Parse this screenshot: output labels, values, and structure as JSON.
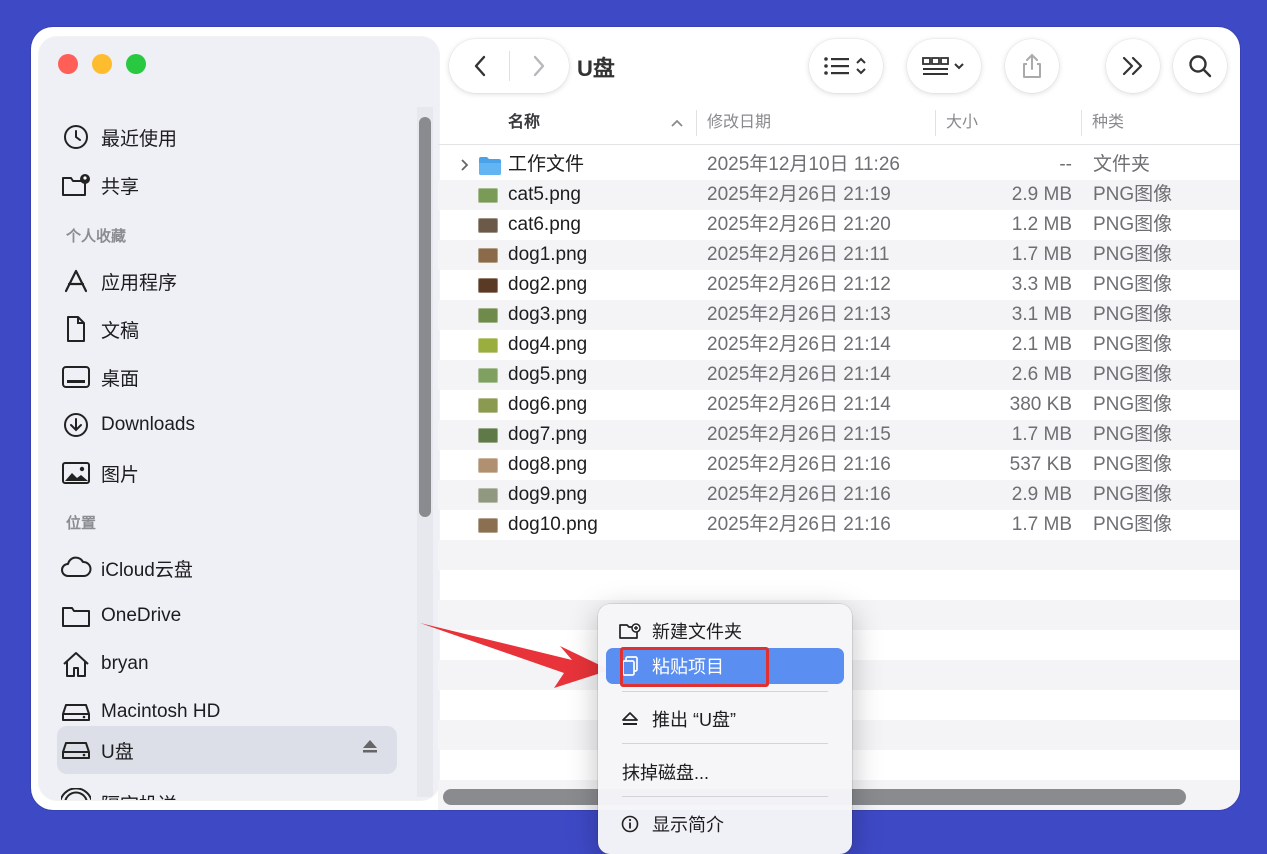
{
  "window": {
    "title": "U盘"
  },
  "sidebar": {
    "favorites": [
      {
        "label": "最近使用",
        "icon": "clock-icon"
      },
      {
        "label": "共享",
        "icon": "shared-folder-icon"
      }
    ],
    "section_personal": "个人收藏",
    "personal": [
      {
        "label": "应用程序",
        "icon": "applications-icon"
      },
      {
        "label": "文稿",
        "icon": "document-icon"
      },
      {
        "label": "桌面",
        "icon": "desktop-icon"
      },
      {
        "label": "Downloads",
        "icon": "download-icon"
      },
      {
        "label": "图片",
        "icon": "pictures-icon"
      }
    ],
    "section_locations": "位置",
    "locations": [
      {
        "label": "iCloud云盘",
        "icon": "cloud-icon"
      },
      {
        "label": "OneDrive",
        "icon": "folder-icon"
      },
      {
        "label": "bryan",
        "icon": "home-icon"
      },
      {
        "label": "Macintosh HD",
        "icon": "harddisk-icon"
      },
      {
        "label": "U盘",
        "icon": "usb-drive-icon",
        "selected": true
      },
      {
        "label": "隔空投送",
        "icon": "airdrop-icon"
      }
    ]
  },
  "columns": {
    "name": "名称",
    "date": "修改日期",
    "size": "大小",
    "kind": "种类"
  },
  "files": [
    {
      "name": "工作文件",
      "date": "2025年12月10日 11:26",
      "size": "--",
      "kind": "文件夹",
      "is_folder": true
    },
    {
      "name": "cat5.png",
      "date": "2025年2月26日 21:19",
      "size": "2.9 MB",
      "kind": "PNG图像",
      "thumb_color": "#7a9a58"
    },
    {
      "name": "cat6.png",
      "date": "2025年2月26日 21:20",
      "size": "1.2 MB",
      "kind": "PNG图像",
      "thumb_color": "#6b5a48"
    },
    {
      "name": "dog1.png",
      "date": "2025年2月26日 21:11",
      "size": "1.7 MB",
      "kind": "PNG图像",
      "thumb_color": "#8a6a48"
    },
    {
      "name": "dog2.png",
      "date": "2025年2月26日 21:12",
      "size": "3.3 MB",
      "kind": "PNG图像",
      "thumb_color": "#5a3a24"
    },
    {
      "name": "dog3.png",
      "date": "2025年2月26日 21:13",
      "size": "3.1 MB",
      "kind": "PNG图像",
      "thumb_color": "#6f8a4a"
    },
    {
      "name": "dog4.png",
      "date": "2025年2月26日 21:14",
      "size": "2.1 MB",
      "kind": "PNG图像",
      "thumb_color": "#9aae40"
    },
    {
      "name": "dog5.png",
      "date": "2025年2月26日 21:14",
      "size": "2.6 MB",
      "kind": "PNG图像",
      "thumb_color": "#7fa060"
    },
    {
      "name": "dog6.png",
      "date": "2025年2月26日 21:14",
      "size": "380 KB",
      "kind": "PNG图像",
      "thumb_color": "#8a9a50"
    },
    {
      "name": "dog7.png",
      "date": "2025年2月26日 21:15",
      "size": "1.7 MB",
      "kind": "PNG图像",
      "thumb_color": "#5f7a48"
    },
    {
      "name": "dog8.png",
      "date": "2025年2月26日 21:16",
      "size": "537 KB",
      "kind": "PNG图像",
      "thumb_color": "#b09070"
    },
    {
      "name": "dog9.png",
      "date": "2025年2月26日 21:16",
      "size": "2.9 MB",
      "kind": "PNG图像",
      "thumb_color": "#909880"
    },
    {
      "name": "dog10.png",
      "date": "2025年2月26日 21:16",
      "size": "1.7 MB",
      "kind": "PNG图像",
      "thumb_color": "#8a7050"
    }
  ],
  "context_menu": {
    "new_folder": "新建文件夹",
    "paste": "粘贴项目",
    "eject": "推出 “U盘”",
    "erase": "抹掉磁盘...",
    "get_info": "显示简介"
  },
  "colors": {
    "background": "#3e49c6",
    "menu_highlight": "#5a8ef0",
    "annotation_red": "#e03030"
  }
}
